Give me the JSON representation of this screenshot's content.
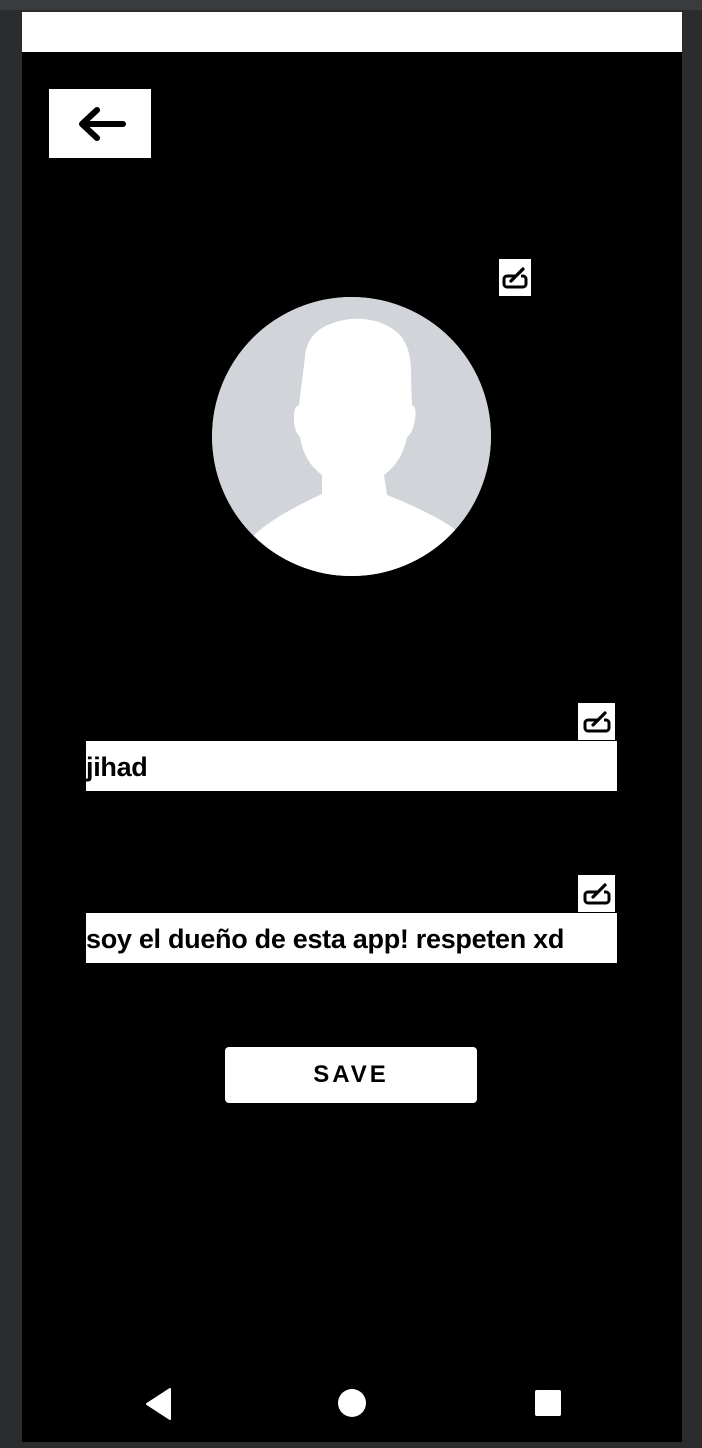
{
  "colors": {
    "background": "#000000",
    "surface": "#ffffff",
    "avatar_bg": "#d1d4d9",
    "avatar_silhouette": "#ffffff",
    "text": "#000000"
  },
  "header": {
    "back_icon": "arrow-left-icon"
  },
  "profile": {
    "avatar_icon": "default-avatar-icon",
    "edit_icon": "edit-icon"
  },
  "form": {
    "name_value": "jihad",
    "bio_value": "soy el dueño de esta app! respeten xd",
    "edit_icon": "edit-icon",
    "save_label": "SAVE"
  },
  "system_nav": {
    "back_icon": "triangle-back-icon",
    "home_icon": "circle-home-icon",
    "recents_icon": "square-recents-icon"
  }
}
